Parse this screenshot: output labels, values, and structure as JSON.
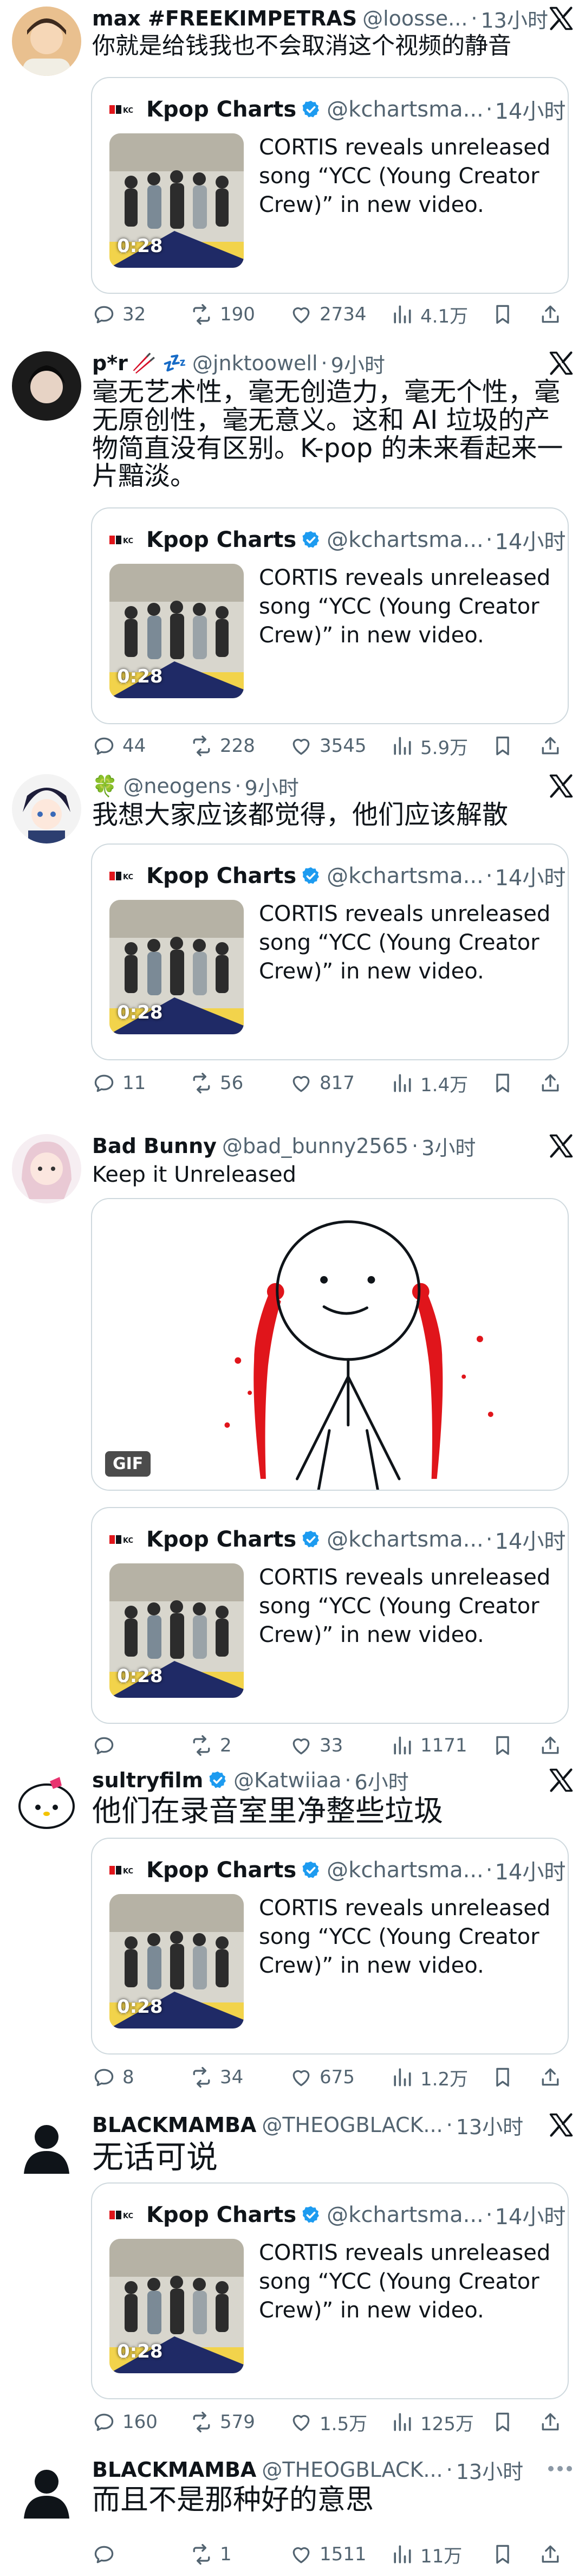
{
  "quote": {
    "name": "Kpop Charts",
    "handle": "@kchartsma...",
    "dot": "·",
    "time": "14小时",
    "text": "CORTIS reveals unreleased song “YCC (Young Creator Crew)” in new video.",
    "duration": "0:28"
  },
  "tweets": [
    {
      "name": "max #FREEKIMPETRAS",
      "handle": "@loosse...",
      "dot": "·",
      "time": "13小时",
      "text": "你就是给钱我也不会取消这个视频的静音",
      "stats": {
        "replies": "32",
        "retweets": "190",
        "likes": "2734",
        "views": "4.1万"
      }
    },
    {
      "name": "p*r",
      "emoji": "🥢 💤",
      "handle": "@jnktoowell",
      "dot": "·",
      "time": "9小时",
      "text": "毫无艺术性，毫无创造力，毫无个性，毫无原创性，毫无意义。这和 AI 垃圾的产物简直没有区别。K-pop 的未来看起来一片黯淡。",
      "stats": {
        "replies": "44",
        "retweets": "228",
        "likes": "3545",
        "views": "5.9万"
      }
    },
    {
      "name": "🍀",
      "handle": "@neogens",
      "dot": "·",
      "time": "9小时",
      "text": "我想大家应该都觉得，他们应该解散",
      "stats": {
        "replies": "11",
        "retweets": "56",
        "likes": "817",
        "views": "1.4万"
      }
    },
    {
      "name": "Bad Bunny",
      "handle": "@bad_bunny2565",
      "dot": "·",
      "time": "3小时",
      "text": "Keep it Unreleased",
      "gif_label": "GIF",
      "stats": {
        "replies": "",
        "retweets": "2",
        "likes": "33",
        "views": "1171"
      }
    },
    {
      "name": "sultryfilm",
      "handle": "@Katwiiaa",
      "dot": "·",
      "time": "6小时",
      "text": "他们在录音室里净整些垃圾",
      "stats": {
        "replies": "8",
        "retweets": "34",
        "likes": "675",
        "views": "1.2万"
      }
    },
    {
      "name": "BLACKMAMBA",
      "handle": "@THEOGBLACK...",
      "dot": "·",
      "time": "13小时",
      "text": "无话可说",
      "stats": {
        "replies": "160",
        "retweets": "579",
        "likes": "1.5万",
        "views": "125万"
      }
    },
    {
      "name": "BLACKMAMBA",
      "handle": "@THEOGBLACK...",
      "dot": "·",
      "time": "13小时",
      "text": "而且不是那种好的意思",
      "stats": {
        "replies": "",
        "retweets": "1",
        "likes": "1511",
        "views": "11万"
      }
    }
  ],
  "colors": {
    "text": "#0f1419",
    "secondary": "#536471",
    "border": "#cfd9de",
    "verified": "#1d9bf0",
    "blood_red": "#e0151b"
  },
  "icons": [
    "reply-icon",
    "retweet-icon",
    "like-icon",
    "views-icon",
    "bookmark-icon",
    "share-icon",
    "x-logo-icon",
    "verified-badge-icon",
    "more-icon"
  ]
}
